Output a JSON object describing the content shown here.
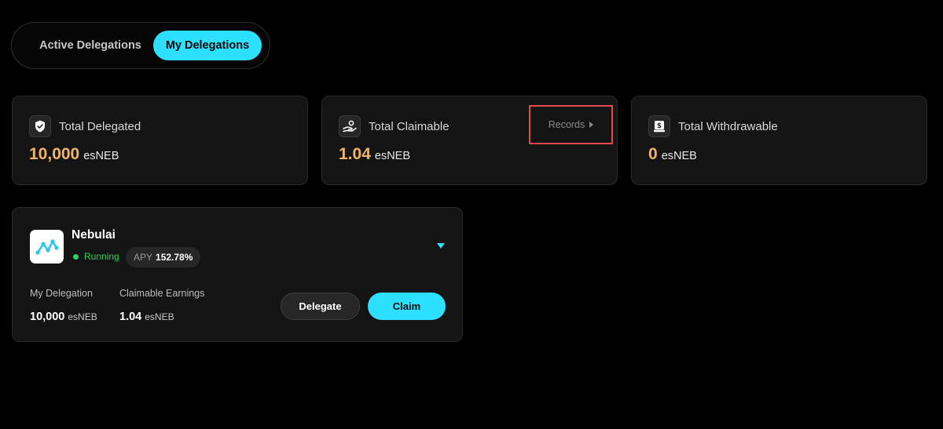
{
  "tabs": {
    "active_delegations": "Active Delegations",
    "my_delegations": "My Delegations"
  },
  "stats": {
    "total_delegated": {
      "title": "Total Delegated",
      "value": "10,000",
      "unit": "esNEB",
      "icon": "shield-check-icon"
    },
    "total_claimable": {
      "title": "Total Claimable",
      "value": "1.04",
      "unit": "esNEB",
      "icon": "hand-coin-icon",
      "records_label": "Records"
    },
    "total_withdrawable": {
      "title": "Total Withdrawable",
      "value": "0",
      "unit": "esNEB",
      "icon": "wallet-icon"
    }
  },
  "node": {
    "name": "Nebulai",
    "status": "Running",
    "apy_label": "APY",
    "apy_value": "152.78%",
    "my_delegation_label": "My Delegation",
    "my_delegation_value": "10,000",
    "my_delegation_unit": "esNEB",
    "claimable_label": "Claimable Earnings",
    "claimable_value": "1.04",
    "claimable_unit": "esNEB",
    "delegate_button": "Delegate",
    "claim_button": "Claim"
  },
  "colors": {
    "accent": "#2ee0ff",
    "value_orange": "#f2b46a",
    "status_green": "#30d158",
    "highlight_red": "#e5484d"
  }
}
